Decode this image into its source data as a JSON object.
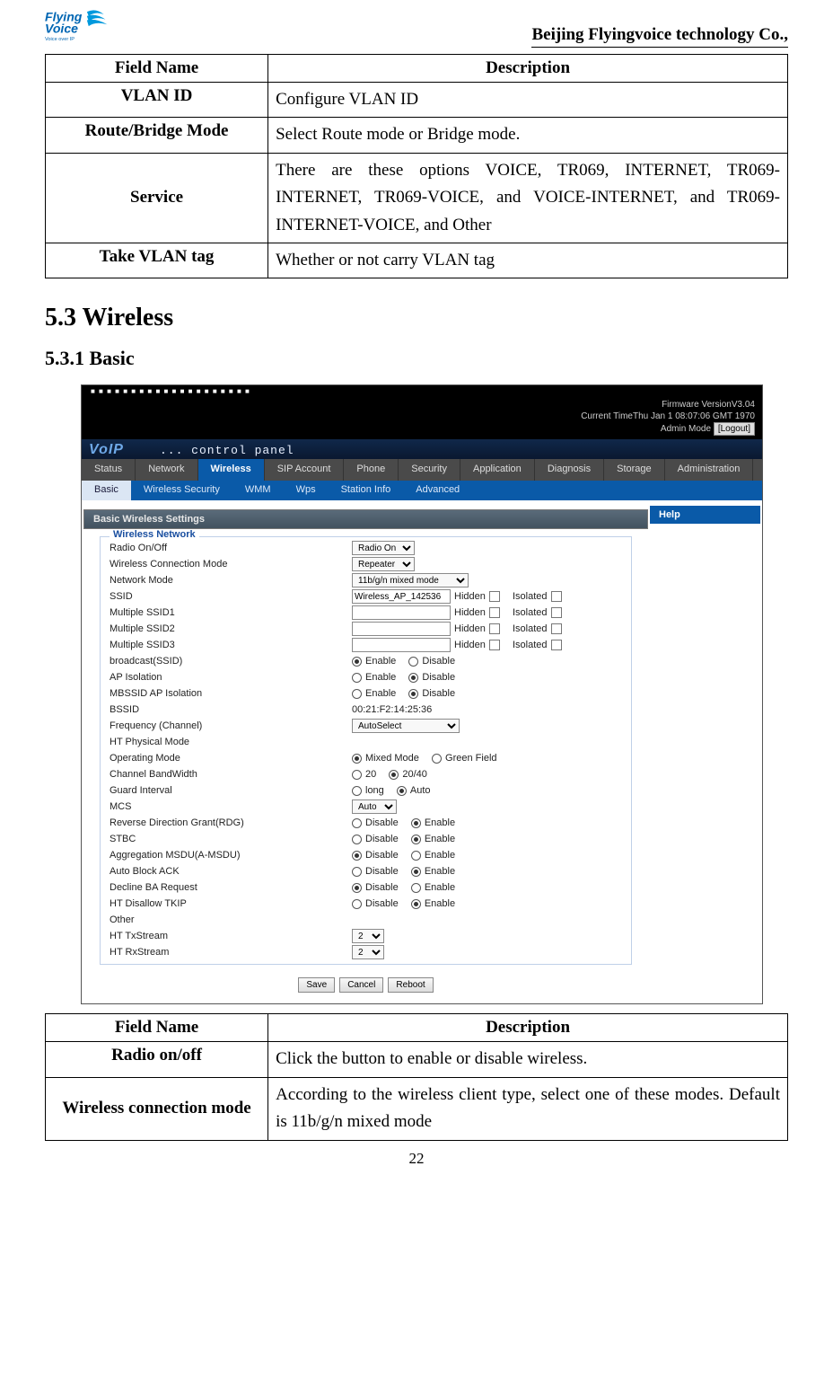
{
  "header": {
    "company": "Beijing Flyingvoice technology Co.,",
    "logo_top": "Flying",
    "logo_sub": "Voice",
    "logo_tag": "Voice over IP"
  },
  "table1": {
    "h_field": "Field Name",
    "h_desc": "Description",
    "rows": [
      {
        "name": "VLAN ID",
        "desc": "Configure VLAN ID"
      },
      {
        "name": "Route/Bridge Mode",
        "desc": "Select Route mode or Bridge mode."
      },
      {
        "name": "Service",
        "desc": "There are these options VOICE, TR069, INTERNET, TR069-INTERNET, TR069-VOICE, and VOICE-INTERNET, and TR069-INTERNET-VOICE, and Other"
      },
      {
        "name": "Take VLAN tag",
        "desc": "Whether or not carry VLAN tag"
      }
    ]
  },
  "section_heading": "5.3 Wireless",
  "subsection_heading": "5.3.1 Basic",
  "screenshot": {
    "firmware": "Firmware VersionV3.04",
    "time": "Current TimeThu Jan 1 08:07:06 GMT 1970",
    "admin_mode": "Admin Mode",
    "logout": "[Logout]",
    "brand": "VoIP",
    "ctlpanel": "... control panel",
    "mainnav": [
      "Status",
      "Network",
      "Wireless",
      "SIP Account",
      "Phone",
      "Security",
      "Application",
      "Diagnosis",
      "Storage",
      "Administration"
    ],
    "mainnav_active": 2,
    "subnav": [
      "Basic",
      "Wireless Security",
      "WMM",
      "Wps",
      "Station Info",
      "Advanced"
    ],
    "subnav_active": 0,
    "panel_title": "Basic Wireless Settings",
    "help_title": "Help",
    "group_legend": "Wireless Network",
    "labels": {
      "radio": "Radio On/Off",
      "conn_mode": "Wireless Connection Mode",
      "net_mode": "Network Mode",
      "ssid": "SSID",
      "mssid1": "Multiple SSID1",
      "mssid2": "Multiple SSID2",
      "mssid3": "Multiple SSID3",
      "bcast": "broadcast(SSID)",
      "apiso": "AP Isolation",
      "mbssid": "MBSSID AP Isolation",
      "bssid": "BSSID",
      "freq": "Frequency (Channel)",
      "htphys": "HT Physical Mode",
      "opmode": "Operating Mode",
      "chbw": "Channel BandWidth",
      "guard": "Guard Interval",
      "mcs": "MCS",
      "rdg": "Reverse Direction Grant(RDG)",
      "stbc": "STBC",
      "amsdu": "Aggregation MSDU(A-MSDU)",
      "ablock": "Auto Block ACK",
      "dba": "Decline BA Request",
      "tkip": "HT Disallow TKIP",
      "other": "Other",
      "txs": "HT TxStream",
      "rxs": "HT RxStream",
      "hidden": "Hidden",
      "isolated": "Isolated",
      "enable": "Enable",
      "disable": "Disable",
      "mixed": "Mixed Mode",
      "green": "Green Field",
      "t20": "20",
      "t2040": "20/40",
      "long": "long",
      "auto": "Auto"
    },
    "values": {
      "radio_sel": "Radio On",
      "conn_sel": "Repeater",
      "net_sel": "11b/g/n mixed mode",
      "ssid_val": "Wireless_AP_142536",
      "bssid_val": "00:21:F2:14:25:36",
      "freq_sel": "AutoSelect",
      "mcs_sel": "Auto",
      "tx_sel": "2",
      "rx_sel": "2"
    },
    "buttons": {
      "save": "Save",
      "cancel": "Cancel",
      "reboot": "Reboot"
    }
  },
  "table2": {
    "h_field": "Field Name",
    "h_desc": "Description",
    "rows": [
      {
        "name": "Radio on/off",
        "desc": "Click the button to enable or disable wireless."
      },
      {
        "name": "Wireless connection mode",
        "desc": "According to the wireless client type, select one of these modes. Default is 11b/g/n mixed mode"
      }
    ]
  },
  "page_number": "22"
}
